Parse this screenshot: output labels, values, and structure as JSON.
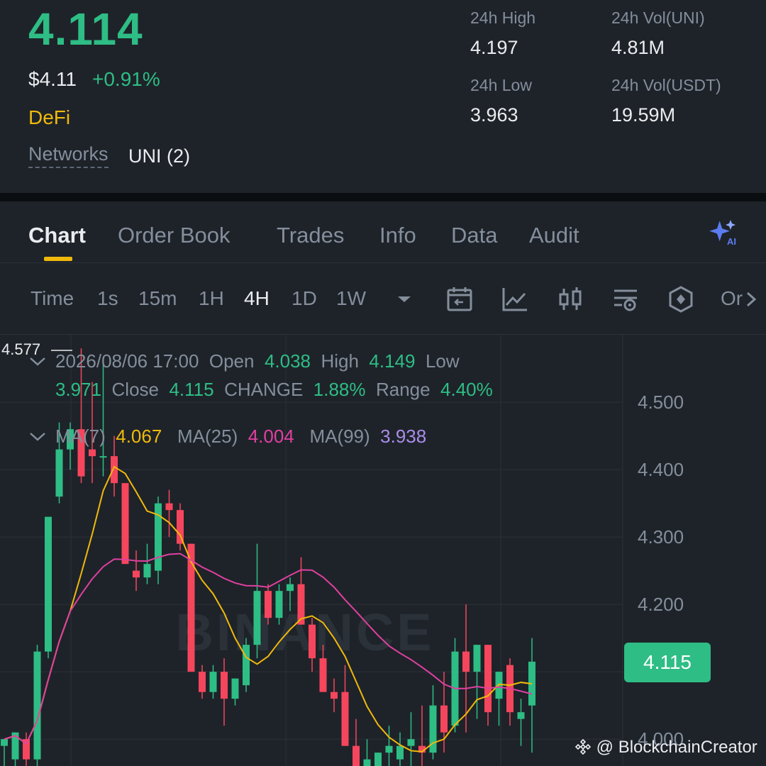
{
  "ticker": {
    "last_price": "4.114",
    "usd_price": "$4.11",
    "change_pct": "+0.91%",
    "tag": "DeFi",
    "networks_label": "Networks",
    "networks_value": "UNI (2)"
  },
  "stats": {
    "high_label": "24h High",
    "high_value": "4.197",
    "vol_uni_label": "24h Vol(UNI)",
    "vol_uni_value": "4.81M",
    "low_label": "24h Low",
    "low_value": "3.963",
    "vol_usdt_label": "24h Vol(USDT)",
    "vol_usdt_value": "19.59M"
  },
  "tabs": [
    "Chart",
    "Order Book",
    "Trades",
    "Info",
    "Data",
    "Audit"
  ],
  "active_tab": "Chart",
  "timeframes": [
    "Time",
    "1s",
    "15m",
    "1H",
    "4H",
    "1D",
    "1W"
  ],
  "active_timeframe": "4H",
  "toolbar_icons": [
    "chevron-down-icon",
    "calendar-icon",
    "line-chart-icon",
    "candlestick-icon",
    "indicator-settings-icon",
    "hexagon-icon",
    "more-icon"
  ],
  "toolbar_more_label": "Or",
  "ohlc": {
    "datetime": "2026/08/06 17:00",
    "open_label": "Open",
    "open": "4.038",
    "high_label": "High",
    "high": "4.149",
    "low_label": "Low",
    "low": "3.971",
    "close_label": "Close",
    "close": "4.115",
    "change_label": "CHANGE",
    "change": "1.88%",
    "range_label": "Range",
    "range": "4.40%"
  },
  "ma": {
    "ma7_label": "MA(7)",
    "ma7": "4.067",
    "ma25_label": "MA(25)",
    "ma25": "4.004",
    "ma99_label": "MA(99)",
    "ma99": "3.938"
  },
  "top_marker": "4.577",
  "colors": {
    "up": "#2ebd85",
    "down": "#f6465d",
    "ma7": "#f0b90b",
    "ma25": "#e040a0",
    "ma99": "#a98dea"
  },
  "watermark": "BINANCE",
  "credit": "@ BlockchainCreator",
  "chart_data": {
    "type": "candlestick",
    "interval": "4H",
    "y_ticks": [
      "4.500",
      "4.400",
      "4.300",
      "4.200",
      "4.000"
    ],
    "ylim": [
      3.96,
      4.6
    ],
    "current_price": "4.115",
    "candles": [
      {
        "o": 3.99,
        "h": 4.0,
        "l": 3.96,
        "c": 4.0
      },
      {
        "o": 3.97,
        "h": 4.01,
        "l": 3.96,
        "c": 4.01
      },
      {
        "o": 4.0,
        "h": 4.01,
        "l": 3.96,
        "c": 3.97
      },
      {
        "o": 3.97,
        "h": 4.14,
        "l": 3.96,
        "c": 4.13
      },
      {
        "o": 4.13,
        "h": 4.33,
        "l": 4.12,
        "c": 4.33
      },
      {
        "o": 4.36,
        "h": 4.47,
        "l": 4.35,
        "c": 4.43
      },
      {
        "o": 4.43,
        "h": 4.47,
        "l": 4.4,
        "c": 4.46
      },
      {
        "o": 4.46,
        "h": 4.58,
        "l": 4.38,
        "c": 4.39
      },
      {
        "o": 4.43,
        "h": 4.53,
        "l": 4.38,
        "c": 4.42
      },
      {
        "o": 4.42,
        "h": 4.56,
        "l": 4.39,
        "c": 4.42
      },
      {
        "o": 4.42,
        "h": 4.45,
        "l": 4.36,
        "c": 4.38
      },
      {
        "o": 4.38,
        "h": 4.38,
        "l": 4.26,
        "c": 4.26
      },
      {
        "o": 4.25,
        "h": 4.28,
        "l": 4.22,
        "c": 4.24
      },
      {
        "o": 4.24,
        "h": 4.29,
        "l": 4.23,
        "c": 4.26
      },
      {
        "o": 4.25,
        "h": 4.36,
        "l": 4.23,
        "c": 4.35
      },
      {
        "o": 4.35,
        "h": 4.37,
        "l": 4.3,
        "c": 4.34
      },
      {
        "o": 4.34,
        "h": 4.35,
        "l": 4.28,
        "c": 4.29
      },
      {
        "o": 4.29,
        "h": 4.29,
        "l": 4.1,
        "c": 4.1
      },
      {
        "o": 4.1,
        "h": 4.11,
        "l": 4.06,
        "c": 4.07
      },
      {
        "o": 4.07,
        "h": 4.11,
        "l": 4.06,
        "c": 4.1
      },
      {
        "o": 4.1,
        "h": 4.12,
        "l": 4.02,
        "c": 4.06
      },
      {
        "o": 4.06,
        "h": 4.09,
        "l": 4.05,
        "c": 4.09
      },
      {
        "o": 4.08,
        "h": 4.15,
        "l": 4.07,
        "c": 4.14
      },
      {
        "o": 4.14,
        "h": 4.29,
        "l": 4.12,
        "c": 4.22
      },
      {
        "o": 4.22,
        "h": 4.23,
        "l": 4.17,
        "c": 4.18
      },
      {
        "o": 4.18,
        "h": 4.23,
        "l": 4.17,
        "c": 4.22
      },
      {
        "o": 4.22,
        "h": 4.24,
        "l": 4.19,
        "c": 4.23
      },
      {
        "o": 4.23,
        "h": 4.27,
        "l": 4.17,
        "c": 4.17
      },
      {
        "o": 4.17,
        "h": 4.18,
        "l": 4.1,
        "c": 4.12
      },
      {
        "o": 4.12,
        "h": 4.14,
        "l": 4.07,
        "c": 4.07
      },
      {
        "o": 4.07,
        "h": 4.09,
        "l": 4.04,
        "c": 4.06
      },
      {
        "o": 4.07,
        "h": 4.11,
        "l": 3.99,
        "c": 3.99
      },
      {
        "o": 3.99,
        "h": 4.03,
        "l": 3.96,
        "c": 3.96
      },
      {
        "o": 3.96,
        "h": 4.0,
        "l": 3.96,
        "c": 3.97
      },
      {
        "o": 3.96,
        "h": 3.98,
        "l": 3.96,
        "c": 3.98
      },
      {
        "o": 3.98,
        "h": 4.02,
        "l": 3.96,
        "c": 3.99
      },
      {
        "o": 3.97,
        "h": 4.01,
        "l": 3.96,
        "c": 3.99
      },
      {
        "o": 3.99,
        "h": 4.04,
        "l": 3.96,
        "c": 4.0
      },
      {
        "o": 3.99,
        "h": 4.05,
        "l": 3.96,
        "c": 3.98
      },
      {
        "o": 3.98,
        "h": 4.08,
        "l": 3.97,
        "c": 4.05
      },
      {
        "o": 4.05,
        "h": 4.1,
        "l": 3.98,
        "c": 4.01
      },
      {
        "o": 4.02,
        "h": 4.15,
        "l": 4.01,
        "c": 4.13
      },
      {
        "o": 4.13,
        "h": 4.2,
        "l": 4.01,
        "c": 4.1
      },
      {
        "o": 4.1,
        "h": 4.14,
        "l": 4.03,
        "c": 4.14
      },
      {
        "o": 4.14,
        "h": 4.13,
        "l": 4.02,
        "c": 4.04
      },
      {
        "o": 4.06,
        "h": 4.1,
        "l": 4.02,
        "c": 4.1
      },
      {
        "o": 4.11,
        "h": 4.12,
        "l": 4.02,
        "c": 4.04
      },
      {
        "o": 4.03,
        "h": 4.06,
        "l": 3.99,
        "c": 4.04
      },
      {
        "o": 4.05,
        "h": 4.15,
        "l": 3.98,
        "c": 4.115
      }
    ]
  }
}
